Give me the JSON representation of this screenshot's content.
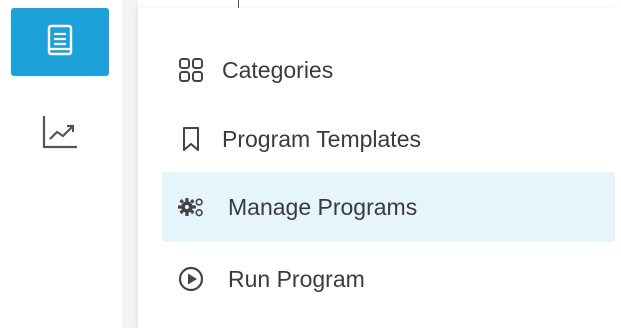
{
  "rail": {
    "items": [
      {
        "name": "document-icon",
        "active": true
      },
      {
        "name": "analytics-icon",
        "active": false
      }
    ],
    "accent_color": "#1da1d9"
  },
  "menu": {
    "items": [
      {
        "label": "Categories",
        "icon": "grid-icon",
        "selected": false
      },
      {
        "label": "Program Templates",
        "icon": "bookmark-icon",
        "selected": false
      },
      {
        "label": "Manage Programs",
        "icon": "gears-icon",
        "selected": true
      },
      {
        "label": "Run Program",
        "icon": "play-circle-icon",
        "selected": false
      }
    ],
    "selected_bg": "#e6f4fb",
    "text_color": "#3b3b3b"
  }
}
